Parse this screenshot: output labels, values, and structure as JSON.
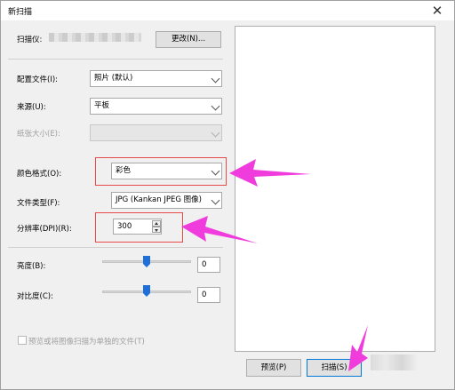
{
  "window": {
    "title": "新扫描",
    "close_glyph": "✕"
  },
  "scanner": {
    "label": "扫描仪:",
    "change_button": "更改(N)..."
  },
  "profile": {
    "label": "配置文件(I):",
    "value": "照片 (默认)"
  },
  "source": {
    "label": "来源(U):",
    "value": "平板"
  },
  "paper_size": {
    "label": "纸张大小(E):",
    "value": ""
  },
  "color_format": {
    "label": "颜色格式(O):",
    "value": "彩色"
  },
  "file_type": {
    "label": "文件类型(F):",
    "value": "JPG (Kankan JPEG 图像)"
  },
  "resolution": {
    "label": "分辨率(DPI)(R):",
    "value": "300"
  },
  "brightness": {
    "label": "亮度(B):",
    "value": "0",
    "level_fraction": 0.5
  },
  "contrast": {
    "label": "对比度(C):",
    "value": "0",
    "level_fraction": 0.5
  },
  "separate_files": {
    "label": "预览或将图像扫描为单独的文件(T)",
    "checked": false
  },
  "buttons": {
    "preview": "预览(P)",
    "scan": "扫描(S)"
  },
  "colors": {
    "annotation_arrow": "#f03cdc",
    "annotation_box": "#e84a4a",
    "slider_thumb": "#1e6fd9"
  }
}
